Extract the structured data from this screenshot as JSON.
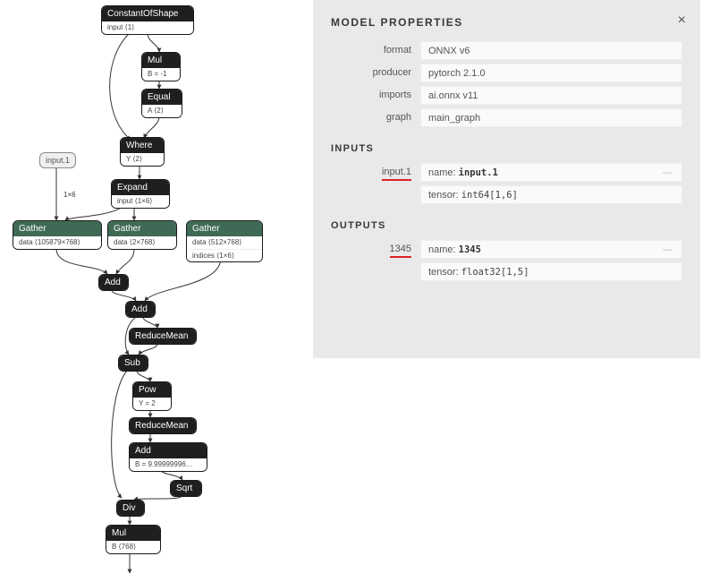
{
  "graph": {
    "inputPill": {
      "label": "input.1"
    },
    "edgeLabel_1x6": "1×6",
    "nodes": {
      "constantOfShape": {
        "title": "ConstantOfShape",
        "attr": "input  ⟨1⟩"
      },
      "mul1": {
        "title": "Mul",
        "attr": "B = -1"
      },
      "equal": {
        "title": "Equal",
        "attr": "A  ⟨2⟩"
      },
      "where": {
        "title": "Where",
        "attr": "Y  ⟨2⟩"
      },
      "expand": {
        "title": "Expand",
        "attr": "input  ⟨1×6⟩"
      },
      "gather1": {
        "title": "Gather",
        "attr": "data  ⟨105879×768⟩"
      },
      "gather2": {
        "title": "Gather",
        "attr": "data  ⟨2×768⟩"
      },
      "gather3": {
        "title": "Gather",
        "attr1": "data  ⟨512×768⟩",
        "attr2": "indices  ⟨1×6⟩"
      },
      "add1": {
        "title": "Add"
      },
      "add2": {
        "title": "Add"
      },
      "reduceMean1": {
        "title": "ReduceMean"
      },
      "sub": {
        "title": "Sub"
      },
      "pow": {
        "title": "Pow",
        "attr": "Y = 2"
      },
      "reduceMean2": {
        "title": "ReduceMean"
      },
      "add3": {
        "title": "Add",
        "attr": "B = 9.99999996…"
      },
      "sqrt": {
        "title": "Sqrt"
      },
      "div": {
        "title": "Div"
      },
      "mul2": {
        "title": "Mul",
        "attr": "B  ⟨768⟩"
      }
    }
  },
  "panel": {
    "title": "MODEL PROPERTIES",
    "sections": {
      "props": [
        {
          "k": "format",
          "v": "ONNX v6"
        },
        {
          "k": "producer",
          "v": "pytorch 2.1.0"
        },
        {
          "k": "imports",
          "v": "ai.onnx v11"
        },
        {
          "k": "graph",
          "v": "main_graph"
        }
      ],
      "inputs": {
        "heading": "INPUTS",
        "rows": [
          {
            "k": "input.1",
            "name": "input.1",
            "tensor": "int64[1,6]"
          }
        ]
      },
      "outputs": {
        "heading": "OUTPUTS",
        "rows": [
          {
            "k": "1345",
            "name": "1345",
            "tensor": "float32[1,5]"
          }
        ]
      }
    }
  }
}
